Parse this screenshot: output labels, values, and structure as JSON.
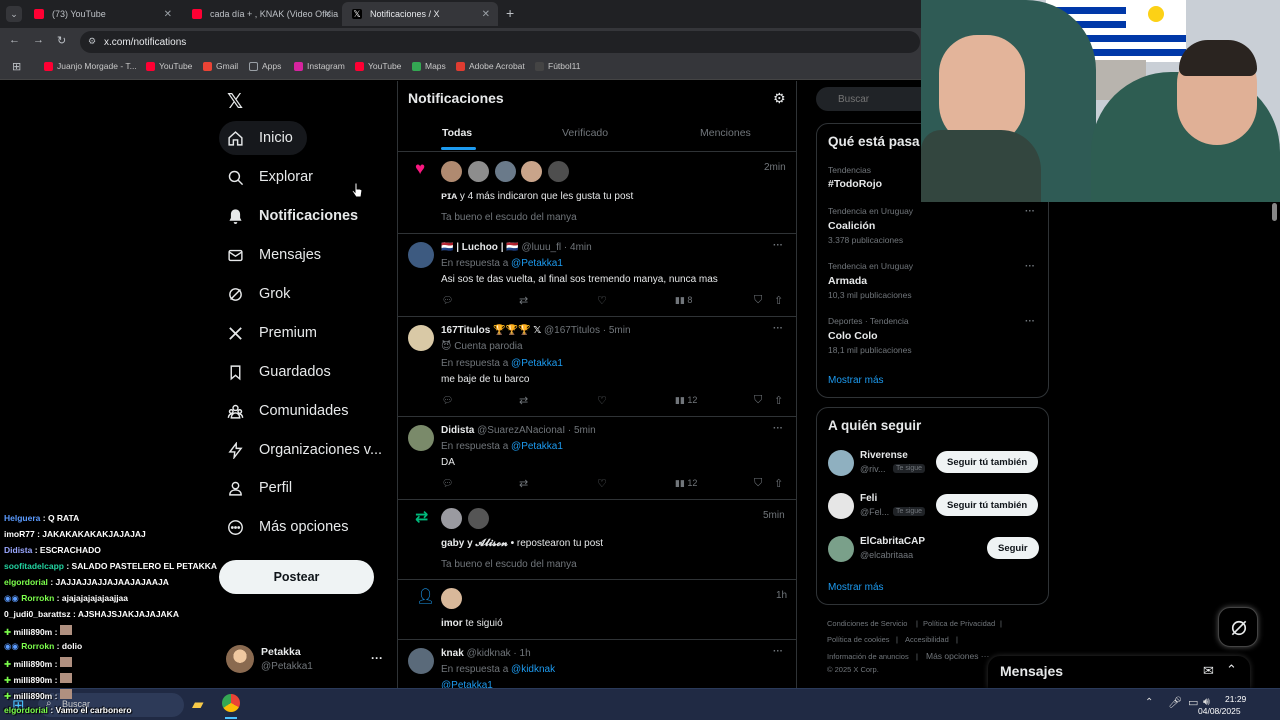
{
  "browser": {
    "tabs": [
      {
        "title": "(73) YouTube",
        "favicon_color": "#ff0033"
      },
      {
        "title": "cada día + , KNAK (Video Oficia",
        "favicon_color": "#ff0033"
      },
      {
        "title": "Notificaciones / X",
        "favicon_color": "#ffffff",
        "active": true
      }
    ],
    "url": "x.com/notifications",
    "bookmarks": [
      {
        "label": "Juanjo Morgade - T...",
        "icon_color": "#ff0033"
      },
      {
        "label": "YouTube",
        "icon_color": "#ff0033"
      },
      {
        "label": "Gmail",
        "icon_color": "#ea4335"
      },
      {
        "label": "Apps",
        "icon_color": "#9aa0a6"
      },
      {
        "label": "Instagram",
        "icon_color": "#d6249f"
      },
      {
        "label": "YouTube",
        "icon_color": "#ff0033"
      },
      {
        "label": "Maps",
        "icon_color": "#34a853"
      },
      {
        "label": "Adobe Acrobat",
        "icon_color": "#e03c31"
      },
      {
        "label": "Fútbol11",
        "icon_color": "#444444"
      }
    ]
  },
  "sidebar": {
    "items": [
      {
        "label": "Inicio",
        "icon": "home-icon"
      },
      {
        "label": "Explorar",
        "icon": "search-icon"
      },
      {
        "label": "Notificaciones",
        "icon": "bell-icon"
      },
      {
        "label": "Mensajes",
        "icon": "mail-icon"
      },
      {
        "label": "Grok",
        "icon": "grok-icon"
      },
      {
        "label": "Premium",
        "icon": "x-logo-icon"
      },
      {
        "label": "Guardados",
        "icon": "bookmark-icon"
      },
      {
        "label": "Comunidades",
        "icon": "communities-icon"
      },
      {
        "label": "Organizaciones v...",
        "icon": "lightning-icon"
      },
      {
        "label": "Perfil",
        "icon": "person-icon"
      },
      {
        "label": "Más opciones",
        "icon": "more-circle-icon"
      }
    ],
    "post_label": "Postear",
    "profile": {
      "name": "Petakka",
      "handle": "@Petakka1",
      "more": "···"
    }
  },
  "main": {
    "title": "Notificaciones",
    "tabs": [
      "Todas",
      "Verificado",
      "Menciones"
    ],
    "notifications": [
      {
        "kind": "like",
        "time": "2min",
        "text_user": "ᴘɪᴀ",
        "text": " y 4 más indicaron que les gusta tu post",
        "quote": "Ta bueno el escudo del manya"
      },
      {
        "kind": "reply",
        "name": "🇳🇱 | Luchoo | 🇳🇱",
        "handle": "@luuu_fl",
        "time": "· 4min",
        "reply_prefix": "En respuesta a ",
        "reply_to": "@Petakka1",
        "body": "Asi sos te das vuelta, al final sos tremendo manya, nunca mas",
        "views": "8"
      },
      {
        "kind": "reply",
        "name": "167Titulos 🏆🏆🏆 𝕏",
        "handle": "@167Titulos",
        "time": "· 5min",
        "sub": "😈 Cuenta parodia",
        "reply_prefix": "En respuesta a ",
        "reply_to": "@Petakka1",
        "body": "me baje de tu barco",
        "views": "12"
      },
      {
        "kind": "reply",
        "name": "Didista",
        "handle": "@SuarezANacionaI",
        "time": "· 5min",
        "reply_prefix": "En respuesta a ",
        "reply_to": "@Petakka1",
        "body": "DA",
        "views": "12"
      },
      {
        "kind": "repost",
        "time": "5min",
        "text_users": "gaby y 𝓐𝓵𝓲𝓼𝓸𝓷 •",
        "text": " repostearon tu post",
        "quote": "Ta bueno el escudo del manya"
      },
      {
        "kind": "follow",
        "time": "1h",
        "text_user": "imor",
        "text": " te siguió"
      },
      {
        "kind": "reply",
        "name": "knak",
        "handle": "@kidknak",
        "time": "· 1h",
        "reply_prefix": "En respuesta a ",
        "reply_to": "@kidknak",
        "reply_to2": "@Petakka1"
      }
    ]
  },
  "right": {
    "search_placeholder": "Buscar",
    "trends_title": "Qué está pasa",
    "trends": [
      {
        "category": "Tendencias",
        "name": "#TodoRojo",
        "count": ""
      },
      {
        "category": "Tendencia en Uruguay",
        "name": "Coalición",
        "count": "3.378 publicaciones"
      },
      {
        "category": "Tendencia en Uruguay",
        "name": "Armada",
        "count": "10,3 mil publicaciones"
      },
      {
        "category": "Deportes · Tendencia",
        "name": "Colo Colo",
        "count": "18,1 mil publicaciones"
      }
    ],
    "show_more": "Mostrar más",
    "follow_title": "A quién seguir",
    "follow": [
      {
        "name": "Riverense",
        "handle": "@riv...",
        "badge": "Te sigue",
        "button": "Seguir tú también"
      },
      {
        "name": "Feli",
        "handle": "@Fel...",
        "badge": "Te sigue",
        "button": "Seguir tú también"
      },
      {
        "name": "ElCabritaCAP",
        "handle": "@elcabritaaa",
        "badge": "",
        "button": "Seguir"
      }
    ],
    "footer": [
      "Condiciones de Servicio",
      "|",
      "Política de Privacidad",
      "|",
      "Política de cookies",
      "|",
      "Accesibilidad",
      "|",
      "Información de anuncios",
      "|",
      "Más opciones ···",
      "© 2025 X Corp."
    ],
    "messages_label": "Mensajes"
  },
  "chat": [
    {
      "user": "Helguera",
      "color": "#5b9bff",
      "msg": ": Q RATA"
    },
    {
      "user": "imoR77",
      "color": "#ffffff",
      "msg": ": JAKAKAKAKAKJAJAJAJ"
    },
    {
      "user": "Didista",
      "color": "#9aa7ff",
      "msg": ": ESCRACHADO"
    },
    {
      "user": "soofitadelcapp",
      "color": "#22d3a0",
      "msg": ": SALADO PASTELERO EL PETAKKA"
    },
    {
      "user": "elgordorial",
      "color": "#7cff4c",
      "msg": ": JAJJAJJAJJAJAAJAJAAJA"
    },
    {
      "user": "Rorrokn",
      "color": "#7cff4c",
      "msg": ": ajajajajajajaajjaa"
    },
    {
      "user": "0_judi0_barattsz",
      "color": "#ffffff",
      "msg": ": AJSHAJSJAKJAJAJAKA"
    },
    {
      "user": "milli890m",
      "color": "#ffffff",
      "msg": ":"
    },
    {
      "user": "Rorrokn",
      "color": "#7cff4c",
      "msg": ": dolio"
    },
    {
      "user": "milli890m",
      "color": "#ffffff",
      "msg": ":"
    },
    {
      "user": "milli890m",
      "color": "#ffffff",
      "msg": ":"
    },
    {
      "user": "milli890m",
      "color": "#ffffff",
      "msg": ":"
    },
    {
      "user": "elgordorial",
      "color": "#7cff4c",
      "msg": ": Vamo el carbonero"
    }
  ],
  "taskbar": {
    "search_label": "Buscar",
    "time": "21:29",
    "date": "04/08/2025"
  }
}
